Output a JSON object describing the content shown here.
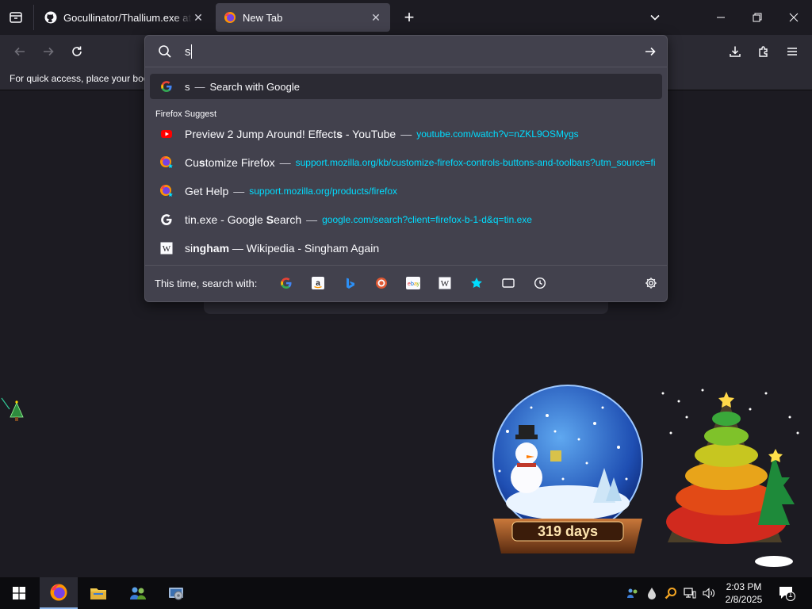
{
  "browser": {
    "tabs": [
      {
        "title": "Gocullinator/Thallium.exe at ma",
        "icon": "github-icon",
        "active": false
      },
      {
        "title": "New Tab",
        "icon": "firefox-icon",
        "active": true
      }
    ],
    "bookmarks_bar_text": "For quick access, place your boo"
  },
  "urlbar": {
    "value": "s",
    "top_suggestion": {
      "typed": "s",
      "dash": "—",
      "text": "Search with Google",
      "icon": "google-icon"
    },
    "section_label": "Firefox Suggest",
    "suggestions": [
      {
        "icon": "youtube-icon",
        "pre": "Preview 2 Jump Around! Effect",
        "bold": "s",
        "post": " - YouTube",
        "dash": "—",
        "url": "youtube.com/watch?v=nZKL9OSMygs"
      },
      {
        "icon": "firefox-icon",
        "pre": "Cu",
        "bold": "s",
        "post": "tomize Firefox",
        "dash": "—",
        "url": "support.mozilla.org/kb/customize-firefox-controls-buttons-and-toolbars?utm_source=fi"
      },
      {
        "icon": "firefox-icon",
        "pre": "Get Help",
        "bold": "",
        "post": "",
        "dash": "—",
        "url": "support.mozilla.org/products/firefox"
      },
      {
        "icon": "google-icon",
        "pre": "tin.exe - Google ",
        "bold": "S",
        "post": "earch",
        "dash": "—",
        "url": "google.com/search?client=firefox-b-1-d&q=tin.exe"
      },
      {
        "icon": "wikipedia-icon",
        "pre": "si",
        "bold": "ngham",
        "post": " — Wikipedia - Singham Again",
        "dash": "",
        "url": ""
      }
    ],
    "one_off_label": "This time, search with:",
    "engines": [
      "google-icon",
      "amazon-icon",
      "bing-icon",
      "duckduckgo-icon",
      "ebay-icon",
      "wikipedia-icon",
      "bookmarks-star-icon",
      "tabs-icon",
      "history-icon"
    ]
  },
  "desktop": {
    "snowglobe_text": "319 days"
  },
  "taskbar": {
    "time": "2:03 PM",
    "date": "2/8/2025",
    "notification_count": "1"
  },
  "colors": {
    "accent_url": "#00ddff",
    "panel": "#42414d",
    "toolbar": "#2b2a33",
    "background": "#1c1b22"
  }
}
